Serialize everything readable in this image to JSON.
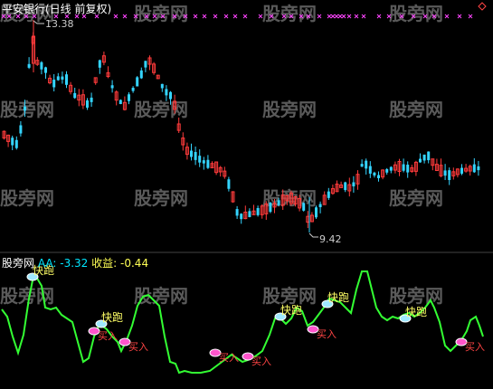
{
  "header": {
    "title": "平安银行(日线 前复权)"
  },
  "price_panel": {
    "max_label": "13.38",
    "min_label": "9.42",
    "colors": {
      "up": "#ff3b3b",
      "down": "#34d4ff",
      "marker": "#ff44ff"
    }
  },
  "indicator": {
    "name": "股旁网",
    "aa_label": "AA:",
    "aa_value": "-3.32",
    "sy_label": "收益:",
    "sy_value": "-0.44",
    "line_color": "#33ff33",
    "signals": [
      {
        "text": "快跑"
      },
      {
        "text": "买入"
      },
      {
        "text": "快跑"
      },
      {
        "text": "买入"
      },
      {
        "text": "买入"
      },
      {
        "text": "买入"
      },
      {
        "text": "快跑"
      },
      {
        "text": "买入"
      },
      {
        "text": "快跑"
      },
      {
        "text": "快跑"
      },
      {
        "text": "买入"
      }
    ]
  },
  "watermark": "股旁网"
}
